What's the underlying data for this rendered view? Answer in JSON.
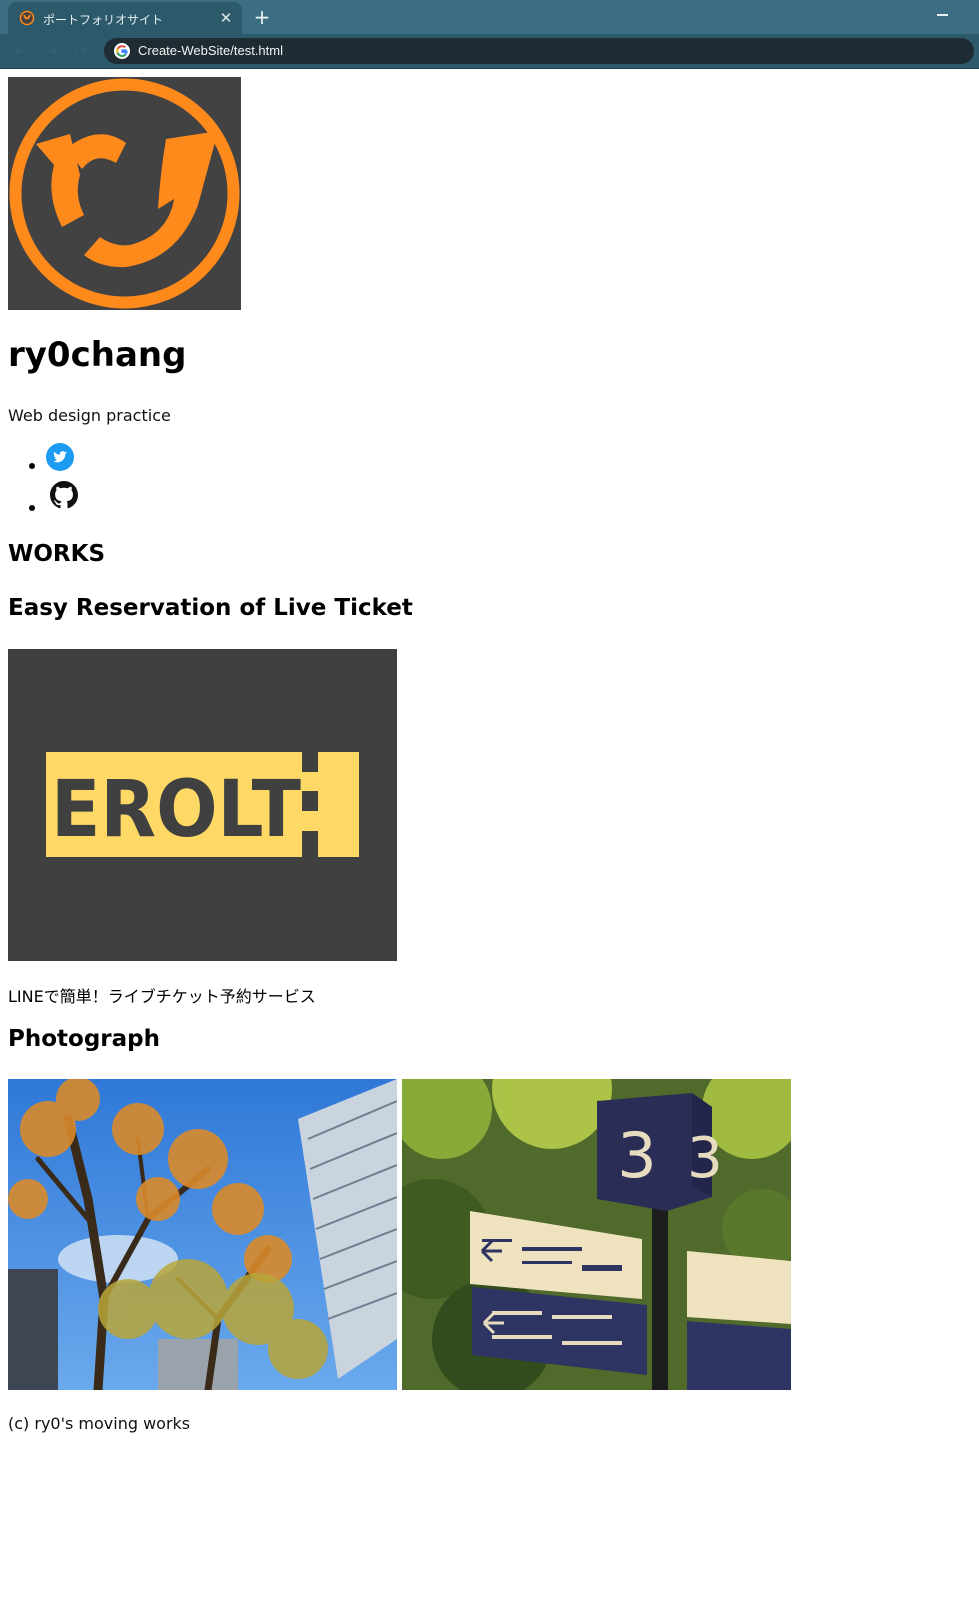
{
  "browser": {
    "tab_title": "ポートフォリオサイト",
    "tab_close": "✕",
    "new_tab": "+",
    "url": "Create-WebSite/test.html",
    "back": "←",
    "forward": "→",
    "reload": "⟳"
  },
  "profile": {
    "logo_text": "ry",
    "name": "ry0chang",
    "tagline": "Web design practice",
    "social": [
      {
        "icon": "twitter-icon"
      },
      {
        "icon": "github-icon"
      }
    ]
  },
  "works": {
    "heading": "WORKS",
    "items": [
      {
        "title": "Easy Reservation of Live Ticket",
        "image_text": "EROLT",
        "description": "LINEで簡単！ライブチケット予約サービス"
      }
    ]
  },
  "photograph": {
    "heading": "Photograph",
    "sign_number": "3"
  },
  "footer": {
    "text": "(c) ry0's moving works"
  },
  "colors": {
    "accent_orange": "#ff8a1c",
    "logo_bg": "#424242",
    "erolt_yellow": "#ffd966",
    "twitter_blue": "#1d9bf0",
    "tab_bar": "#3b6e82"
  }
}
